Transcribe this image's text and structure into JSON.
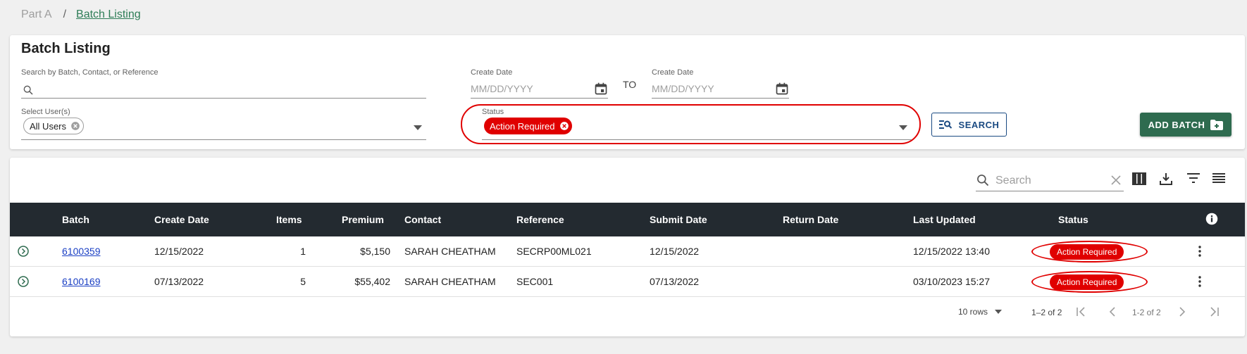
{
  "breadcrumb": {
    "parent": "Part A",
    "separator": "/",
    "current": "Batch Listing"
  },
  "filters": {
    "title": "Batch Listing",
    "search_label": "Search by Batch, Contact, or Reference",
    "search_value": "",
    "create_date_from_label": "Create Date",
    "create_date_from_placeholder": "MM/DD/YYYY",
    "to_label": "TO",
    "create_date_to_label": "Create Date",
    "create_date_to_placeholder": "MM/DD/YYYY",
    "users_label": "Select User(s)",
    "users_chip": "All Users",
    "status_label": "Status",
    "status_chip": "Action Required",
    "search_button": "SEARCH",
    "add_button": "ADD BATCH"
  },
  "toolbar": {
    "search_placeholder": "Search"
  },
  "table": {
    "columns": [
      "Batch",
      "Create Date",
      "Items",
      "Premium",
      "Contact",
      "Reference",
      "Submit Date",
      "Return Date",
      "Last Updated",
      "Status"
    ],
    "rows": [
      {
        "batch": "6100359",
        "create_date": "12/15/2022",
        "items": "1",
        "premium": "$5,150",
        "contact": "SARAH CHEATHAM",
        "reference": "SECRP00ML021",
        "submit_date": "12/15/2022",
        "return_date": "",
        "last_updated": "12/15/2022 13:40",
        "status": "Action Required"
      },
      {
        "batch": "6100169",
        "create_date": "07/13/2022",
        "items": "5",
        "premium": "$55,402",
        "contact": "SARAH CHEATHAM",
        "reference": "SEC001",
        "submit_date": "07/13/2022",
        "return_date": "",
        "last_updated": "03/10/2023 15:27",
        "status": "Action Required"
      }
    ]
  },
  "pagination": {
    "rows_per_page": "10 rows",
    "range": "1–2 of 2",
    "range_secondary": "1-2 of 2"
  },
  "colors": {
    "accent_green": "#2e6b4f",
    "header_dark": "#232a30",
    "status_red": "#e00000",
    "link_blue": "#1a3fc4",
    "search_blue": "#1a4a82"
  },
  "icons": [
    "search-icon",
    "calendar-icon",
    "close-circle-icon",
    "dropdown-caret-icon",
    "search-list-icon",
    "folder-add-icon",
    "clear-icon",
    "columns-icon",
    "download-icon",
    "filter-icon",
    "density-icon",
    "info-icon",
    "expand-circle-icon",
    "more-vertical-icon",
    "first-page-icon",
    "prev-page-icon",
    "next-page-icon",
    "last-page-icon"
  ]
}
